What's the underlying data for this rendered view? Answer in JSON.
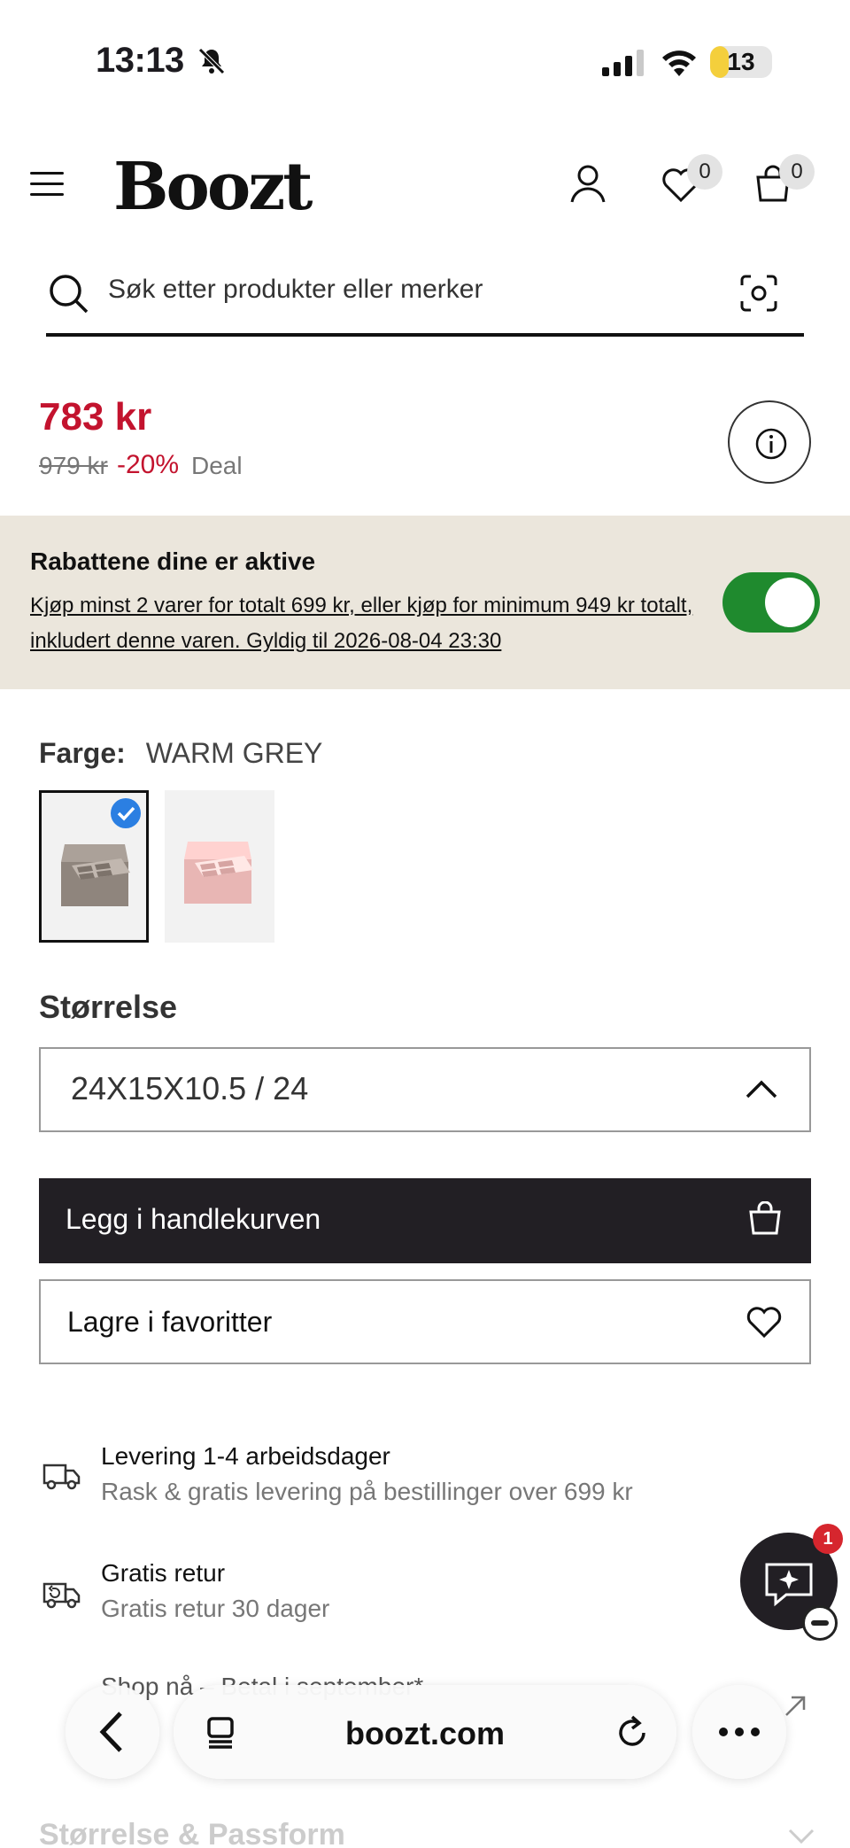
{
  "status_bar": {
    "time": "13:13",
    "battery": "13",
    "battery_level": 0.13
  },
  "header": {
    "logo": "Boozt",
    "wishlist_count": "0",
    "cart_count": "0"
  },
  "search": {
    "placeholder": "Søk etter produkter eller merker"
  },
  "product": {
    "price": "783 kr",
    "old_price": "979 kr",
    "discount": "-20%",
    "deal_label": "Deal"
  },
  "discount_panel": {
    "title": "Rabattene dine er aktive",
    "description": "Kjøp minst 2 varer for totalt 699 kr, eller kjøp for minimum 949 kr totalt, inkludert denne varen. Gyldig til 2026-08-04 23:30",
    "toggle_on": true
  },
  "color": {
    "label": "Farge:",
    "value": "WARM GREY",
    "swatches": [
      {
        "color": "#8f857d",
        "selected": true
      },
      {
        "color": "#e8b6b4",
        "selected": false
      }
    ]
  },
  "size": {
    "label": "Størrelse",
    "value": "24X15X10.5 / 24"
  },
  "buttons": {
    "add_to_cart": "Legg i handlekurven",
    "save_favorite": "Lagre i favoritter"
  },
  "info": [
    {
      "title": "Levering 1-4 arbeidsdager",
      "subtitle": "Rask & gratis levering på bestillinger over 699 kr"
    },
    {
      "title": "Gratis retur",
      "subtitle": "Gratis retur 30 dager"
    }
  ],
  "shop_now": "Shop nå – Betal i september*",
  "size_fit": "Størrelse & Passform",
  "chat": {
    "badge": "1"
  },
  "browser": {
    "url": "boozt.com"
  },
  "colors": {
    "accent_red": "#c3132e",
    "toggle_green": "#1f8a2e",
    "dark": "#221f24",
    "panel_bg": "#ebe6dc"
  }
}
